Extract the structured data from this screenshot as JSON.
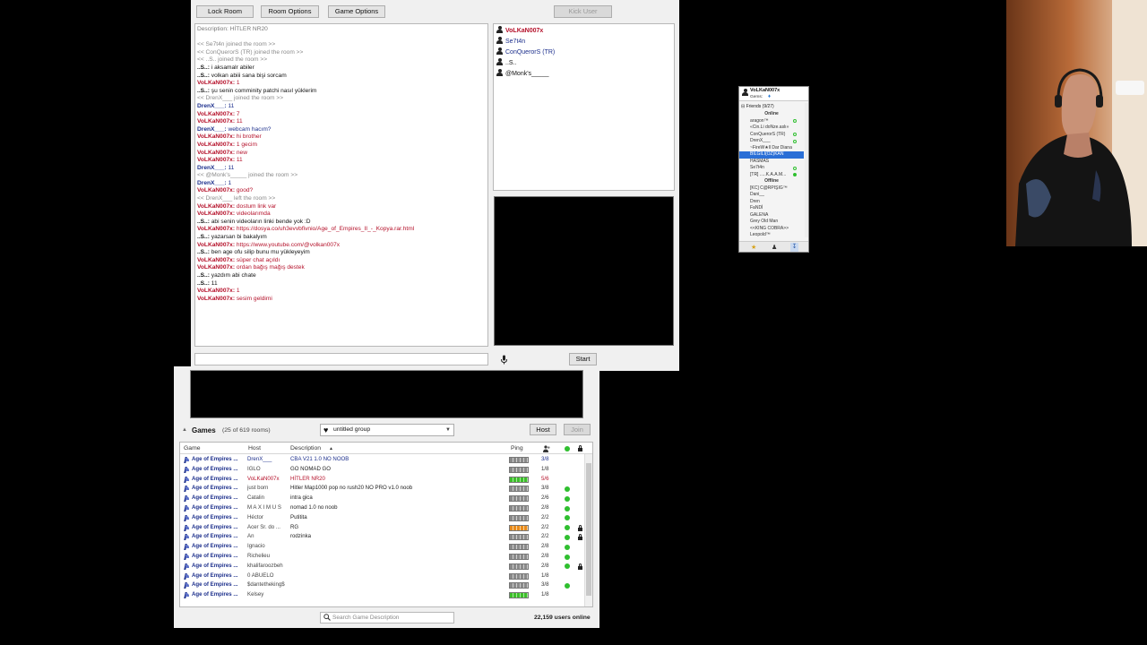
{
  "room": {
    "buttons": {
      "lock_room": "Lock Room",
      "room_options": "Room Options",
      "game_options": "Game Options",
      "kick_user": "Kick User"
    },
    "chat": [
      {
        "type": "desc",
        "text": "Description: HİTLER NR20"
      },
      {
        "type": "blank",
        "text": ""
      },
      {
        "type": "sys",
        "text": "<< Se7t4n joined the room >>"
      },
      {
        "type": "sys",
        "text": "<< ConQuerorS (TR) joined the room >>"
      },
      {
        "type": "sys",
        "text": "<< ..S.. joined the room >>"
      },
      {
        "type": "msg",
        "nick": "..S..:",
        "text": "i aksamalr abiler",
        "color": "blk"
      },
      {
        "type": "msg",
        "nick": "..S..:",
        "text": "volkan abiii sana bişi sorcam",
        "color": "blk"
      },
      {
        "type": "msg",
        "nick": "VoLKaN007x:",
        "text": "1",
        "color": "red"
      },
      {
        "type": "msg",
        "nick": "..S..:",
        "text": "şu senin comminity patchi nasıl yüklerim",
        "color": "blk"
      },
      {
        "type": "sys",
        "text": "<< DrenX___ joined the room >>"
      },
      {
        "type": "msg",
        "nick": "DrenX___:",
        "text": "11",
        "color": "blue"
      },
      {
        "type": "msg",
        "nick": "VoLKaN007x:",
        "text": "7",
        "color": "red"
      },
      {
        "type": "msg",
        "nick": "VoLKaN007x:",
        "text": "11",
        "color": "red"
      },
      {
        "type": "msg",
        "nick": "DrenX___:",
        "text": "webcam hacım?",
        "color": "blue"
      },
      {
        "type": "msg",
        "nick": "VoLKaN007x:",
        "text": "hi brother",
        "color": "red"
      },
      {
        "type": "msg",
        "nick": "VoLKaN007x:",
        "text": "1 gecim",
        "color": "red"
      },
      {
        "type": "msg",
        "nick": "VoLKaN007x:",
        "text": "new",
        "color": "red"
      },
      {
        "type": "msg",
        "nick": "VoLKaN007x:",
        "text": "11",
        "color": "red"
      },
      {
        "type": "msg",
        "nick": "DrenX___:",
        "text": "11",
        "color": "blue"
      },
      {
        "type": "sys",
        "text": "<< @Monk's_____ joined the room >>"
      },
      {
        "type": "msg",
        "nick": "DrenX___:",
        "text": "1",
        "color": "blue"
      },
      {
        "type": "msg",
        "nick": "VoLKaN007x:",
        "text": "good?",
        "color": "red"
      },
      {
        "type": "sys",
        "text": "<< DrenX___ left the room >>"
      },
      {
        "type": "msg",
        "nick": "VoLKaN007x:",
        "text": "dostum link var",
        "color": "red"
      },
      {
        "type": "msg",
        "nick": "VoLKaN007x:",
        "text": "videolarımda",
        "color": "red"
      },
      {
        "type": "msg",
        "nick": "..S..:",
        "text": "abi senin videoların linki bende yok :D",
        "color": "blk"
      },
      {
        "type": "msg",
        "nick": "VoLKaN007x:",
        "text": "https://dosya.co/uh3evvbfivnio/Age_of_Empires_II_-_Kopya.rar.html",
        "color": "red"
      },
      {
        "type": "msg",
        "nick": "..S..:",
        "text": "yazarsan bi bakalyım",
        "color": "blk"
      },
      {
        "type": "msg",
        "nick": "VoLKaN007x:",
        "text": "https://www.youtube.com/@volkan007x",
        "color": "red"
      },
      {
        "type": "msg",
        "nick": "..S..:",
        "text": "ben age ofu silip bunu mu yükleyeyim",
        "color": "blk"
      },
      {
        "type": "msg",
        "nick": "VoLKaN007x:",
        "text": "süper chat açıldı",
        "color": "red"
      },
      {
        "type": "msg",
        "nick": "VoLKaN007x:",
        "text": "ordan bağış mağış destek",
        "color": "red"
      },
      {
        "type": "msg",
        "nick": "..S..:",
        "text": "yazdım abi chate",
        "color": "blk"
      },
      {
        "type": "msg",
        "nick": "..S..:",
        "text": "11",
        "color": "blk"
      },
      {
        "type": "msg",
        "nick": "VoLKaN007x:",
        "text": "1",
        "color": "red"
      },
      {
        "type": "msg",
        "nick": "VoLKaN007x:",
        "text": "sesim geldimi",
        "color": "red"
      }
    ],
    "users": [
      {
        "name": "VoLKaN007x",
        "color": "#b5122b",
        "bold": true
      },
      {
        "name": "Se7t4n",
        "color": "#1c2f8c",
        "bold": false
      },
      {
        "name": "ConQuerorS (TR)",
        "color": "#1c2f8c",
        "bold": false
      },
      {
        "name": "..S..",
        "color": "#111111",
        "bold": false
      },
      {
        "name": "@Monk's_____",
        "color": "#111111",
        "bold": false
      }
    ],
    "start_label": "Start",
    "mic_icon": "microphone-icon"
  },
  "lobby": {
    "section_title": "Games",
    "rooms_count": "(25 of 619 rooms)",
    "group_select": "untitled group",
    "host_button": "Host",
    "join_button": "Join",
    "columns": {
      "game": "Game",
      "host": "Host",
      "description": "Description",
      "ping": "Ping"
    },
    "rows": [
      {
        "game": "Age of Empires ...",
        "host": "DrenX___",
        "desc": "CBA V21 1.0 NO NOOB",
        "ping": "gray",
        "players": "3/8",
        "dot": false,
        "lock": false,
        "hl": "blue"
      },
      {
        "game": "Age of Empires ...",
        "host": "IGLO",
        "desc": "GO NOMAD GO",
        "ping": "gray",
        "players": "1/8",
        "dot": false,
        "lock": false,
        "hl": ""
      },
      {
        "game": "Age of Empires ...",
        "host": "VoLKaN007x",
        "desc": "HİTLER NR20",
        "ping": "green",
        "players": "5/6",
        "dot": false,
        "lock": false,
        "hl": "red"
      },
      {
        "game": "Age of Empires ...",
        "host": "just born",
        "desc": "Hitler Map1000 pop no rush20 NO PRO v1.0 noob",
        "ping": "gray",
        "players": "3/8",
        "dot": true,
        "lock": false,
        "hl": ""
      },
      {
        "game": "Age of Empires ...",
        "host": "Catalin",
        "desc": "intra gica",
        "ping": "gray",
        "players": "2/6",
        "dot": true,
        "lock": false,
        "hl": ""
      },
      {
        "game": "Age of Empires ...",
        "host": "M A X I M U S",
        "desc": "nomad 1.0 no noob",
        "ping": "gray",
        "players": "2/8",
        "dot": true,
        "lock": false,
        "hl": ""
      },
      {
        "game": "Age of Empires ...",
        "host": "Héctor",
        "desc": "Putitita",
        "ping": "gray",
        "players": "2/2",
        "dot": true,
        "lock": false,
        "hl": ""
      },
      {
        "game": "Age of Empires ...",
        "host": "Acer Sr. do ...",
        "desc": "RG",
        "ping": "orange",
        "players": "2/2",
        "dot": true,
        "lock": true,
        "hl": ""
      },
      {
        "game": "Age of Empires ...",
        "host": "An",
        "desc": "rodzinka",
        "ping": "gray",
        "players": "2/2",
        "dot": true,
        "lock": true,
        "hl": ""
      },
      {
        "game": "Age of Empires ...",
        "host": "Ignacio",
        "desc": "",
        "ping": "gray",
        "players": "2/8",
        "dot": true,
        "lock": false,
        "hl": ""
      },
      {
        "game": "Age of Empires ...",
        "host": "Richelieu",
        "desc": "",
        "ping": "gray",
        "players": "2/8",
        "dot": true,
        "lock": false,
        "hl": ""
      },
      {
        "game": "Age of Empires ...",
        "host": "khalifaroozbeh",
        "desc": "",
        "ping": "gray",
        "players": "2/8",
        "dot": true,
        "lock": true,
        "hl": ""
      },
      {
        "game": "Age of Empires ...",
        "host": "0 ABUELO",
        "desc": "",
        "ping": "gray",
        "players": "1/8",
        "dot": false,
        "lock": false,
        "hl": ""
      },
      {
        "game": "Age of Empires ...",
        "host": "$dantetheking$",
        "desc": "",
        "ping": "gray",
        "players": "3/8",
        "dot": true,
        "lock": false,
        "hl": ""
      },
      {
        "game": "Age of Empires ...",
        "host": "Kelsey",
        "desc": "",
        "ping": "green",
        "players": "1/8",
        "dot": false,
        "lock": false,
        "hl": ""
      }
    ],
    "search_placeholder": "Search Game Description",
    "users_online": "22,159 users online"
  },
  "friends": {
    "user": "VoLKaN007x",
    "gems": "Gems:",
    "header": "Friends (9/27)",
    "online_label": "Online",
    "offline_label": "Offline",
    "online": [
      "aragon™",
      "«Cin.Li doNze.aslı»",
      "ConQuerorS (TR)",
      "DrenX___",
      "~FireW★ll Dar Diana",
      "BİLGİLİ(ÖZ)KAN",
      "HASMAS",
      "Se7t4n",
      "[TR] .....K.A.A.M..."
    ],
    "offline": [
      "[KC] C@RPIŞIG™",
      "Dani__",
      "Dren",
      "FaNDİ",
      "GALENA",
      "Grey Old Man",
      "<<KING COBRA>>",
      "Leopold™"
    ]
  }
}
